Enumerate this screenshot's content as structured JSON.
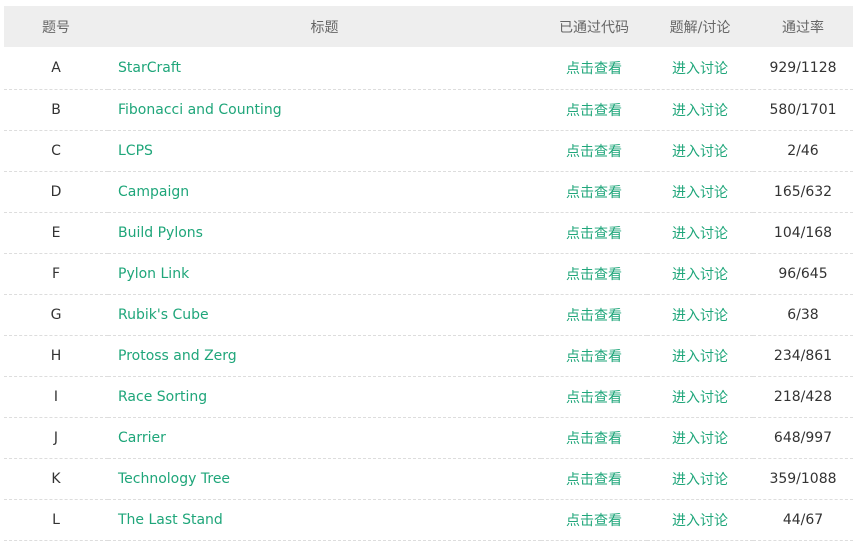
{
  "headers": {
    "id": "题号",
    "title": "标题",
    "code": "已通过代码",
    "discuss": "题解/讨论",
    "rate": "通过率"
  },
  "rows": [
    {
      "id": "A",
      "title": "StarCraft",
      "code": "点击查看",
      "discuss": "进入讨论",
      "rate": "929/1128"
    },
    {
      "id": "B",
      "title": "Fibonacci and Counting",
      "code": "点击查看",
      "discuss": "进入讨论",
      "rate": "580/1701"
    },
    {
      "id": "C",
      "title": "LCPS",
      "code": "点击查看",
      "discuss": "进入讨论",
      "rate": "2/46"
    },
    {
      "id": "D",
      "title": "Campaign",
      "code": "点击查看",
      "discuss": "进入讨论",
      "rate": "165/632"
    },
    {
      "id": "E",
      "title": "Build Pylons",
      "code": "点击查看",
      "discuss": "进入讨论",
      "rate": "104/168"
    },
    {
      "id": "F",
      "title": "Pylon Link",
      "code": "点击查看",
      "discuss": "进入讨论",
      "rate": "96/645"
    },
    {
      "id": "G",
      "title": "Rubik's Cube",
      "code": "点击查看",
      "discuss": "进入讨论",
      "rate": "6/38"
    },
    {
      "id": "H",
      "title": "Protoss and Zerg",
      "code": "点击查看",
      "discuss": "进入讨论",
      "rate": "234/861"
    },
    {
      "id": "I",
      "title": "Race Sorting",
      "code": "点击查看",
      "discuss": "进入讨论",
      "rate": "218/428"
    },
    {
      "id": "J",
      "title": "Carrier",
      "code": "点击查看",
      "discuss": "进入讨论",
      "rate": "648/997"
    },
    {
      "id": "K",
      "title": "Technology Tree",
      "code": "点击查看",
      "discuss": "进入讨论",
      "rate": "359/1088"
    },
    {
      "id": "L",
      "title": "The Last Stand",
      "code": "点击查看",
      "discuss": "进入讨论",
      "rate": "44/67"
    }
  ],
  "colors": {
    "link": "#1fa67a",
    "header_bg": "#eeeeee",
    "header_text": "#666666",
    "body_text": "#333333",
    "row_divider": "#dddddd"
  }
}
